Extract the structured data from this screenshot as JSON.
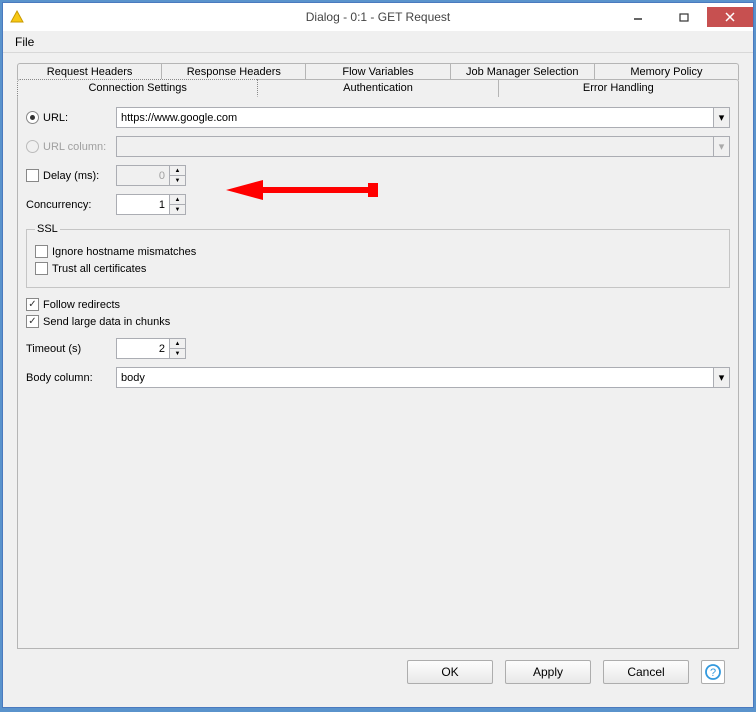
{
  "window": {
    "title": "Dialog - 0:1 - GET Request"
  },
  "menu": {
    "file": "File"
  },
  "tabs_row1": {
    "request_headers": "Request Headers",
    "response_headers": "Response Headers",
    "flow_variables": "Flow Variables",
    "job_manager": "Job Manager Selection",
    "memory_policy": "Memory Policy"
  },
  "tabs_row2": {
    "connection_settings": "Connection Settings",
    "authentication": "Authentication",
    "error_handling": "Error Handling"
  },
  "form": {
    "url_label": "URL:",
    "url_value": "https://www.google.com",
    "url_column_label": "URL column:",
    "url_column_value": "",
    "delay_label": "Delay (ms):",
    "delay_value": "0",
    "concurrency_label": "Concurrency:",
    "concurrency_value": "1",
    "ssl_legend": "SSL",
    "ignore_hostname": "Ignore hostname mismatches",
    "trust_all": "Trust all certificates",
    "follow_redirects": "Follow redirects",
    "send_large": "Send large data in chunks",
    "timeout_label": "Timeout (s)",
    "timeout_value": "2",
    "body_column_label": "Body column:",
    "body_column_value": "body"
  },
  "buttons": {
    "ok": "OK",
    "apply": "Apply",
    "cancel": "Cancel"
  }
}
